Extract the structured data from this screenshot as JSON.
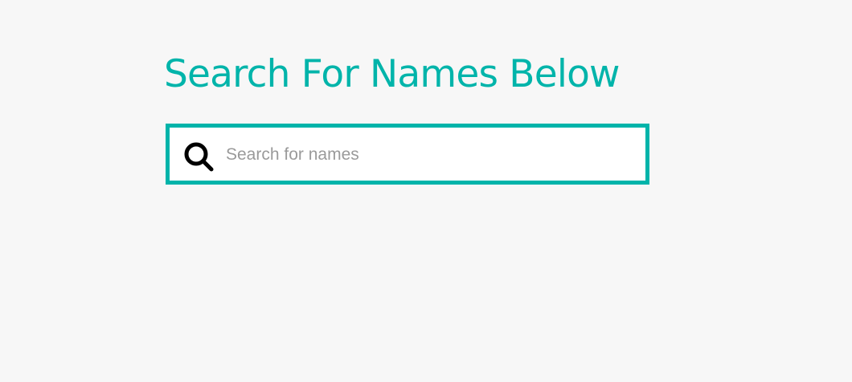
{
  "page": {
    "title": "Search For Names Below"
  },
  "search": {
    "placeholder": "Search for names",
    "value": "",
    "icon": "search-icon"
  },
  "colors": {
    "accent": "#00b4aa",
    "background": "#f7f7f7",
    "input_background": "#ffffff",
    "placeholder": "#9a9a9a",
    "icon": "#000000"
  }
}
